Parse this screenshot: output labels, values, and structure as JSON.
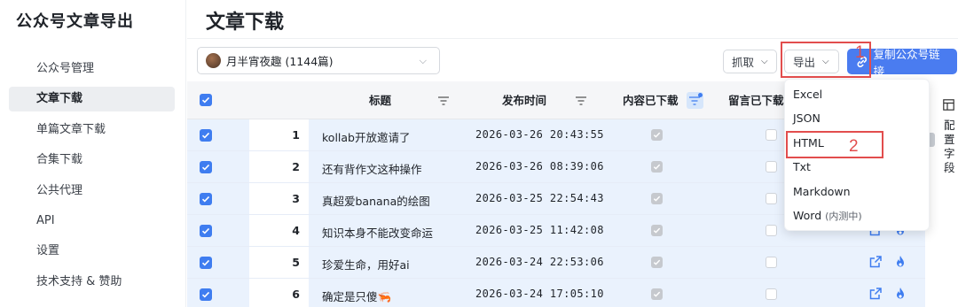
{
  "app": {
    "title": "公众号文章导出"
  },
  "sidebar": {
    "items": [
      {
        "label": "公众号管理",
        "active": false
      },
      {
        "label": "文章下载",
        "active": true
      },
      {
        "label": "单篇文章下载",
        "active": false
      },
      {
        "label": "合集下载",
        "active": false
      },
      {
        "label": "公共代理",
        "active": false
      },
      {
        "label": "API",
        "active": false
      },
      {
        "label": "设置",
        "active": false
      },
      {
        "label": "技术支持 & 赞助",
        "active": false
      }
    ]
  },
  "page": {
    "title": "文章下载"
  },
  "toolbar": {
    "account_label": "月半宵夜趣 (1144篇)",
    "grab_label": "抓取",
    "export_label": "导出",
    "copy_label": "复制公众号链接"
  },
  "table": {
    "columns": [
      "标题",
      "发布时间",
      "内容已下载",
      "留言已下载"
    ],
    "rows": [
      {
        "index": "1",
        "title": "kollab开放邀请了",
        "date": "2026-03-26 20:43:55"
      },
      {
        "index": "2",
        "title": "还有背作文这种操作",
        "date": "2026-03-26 08:39:06"
      },
      {
        "index": "3",
        "title": "真超爱banana的绘图",
        "date": "2026-03-25 22:54:43"
      },
      {
        "index": "4",
        "title": "知识本身不能改变命运",
        "date": "2026-03-25 11:42:08"
      },
      {
        "index": "5",
        "title": "珍爱生命，用好ai",
        "date": "2026-03-24 22:53:06"
      },
      {
        "index": "6",
        "title": "确定是只傻🦐",
        "date": "2026-03-24 17:05:10"
      }
    ]
  },
  "export_menu": {
    "items": [
      "Excel",
      "JSON",
      "HTML",
      "Txt",
      "Markdown",
      "Word"
    ],
    "word_note": "(内测中)"
  },
  "annotations": {
    "step1": "1",
    "step2": "2"
  },
  "config_panel": {
    "label": "配置字段"
  },
  "colors": {
    "accent": "#4a7cf0",
    "annotation": "#e24d4d",
    "row_selected": "#eaf2fd"
  }
}
